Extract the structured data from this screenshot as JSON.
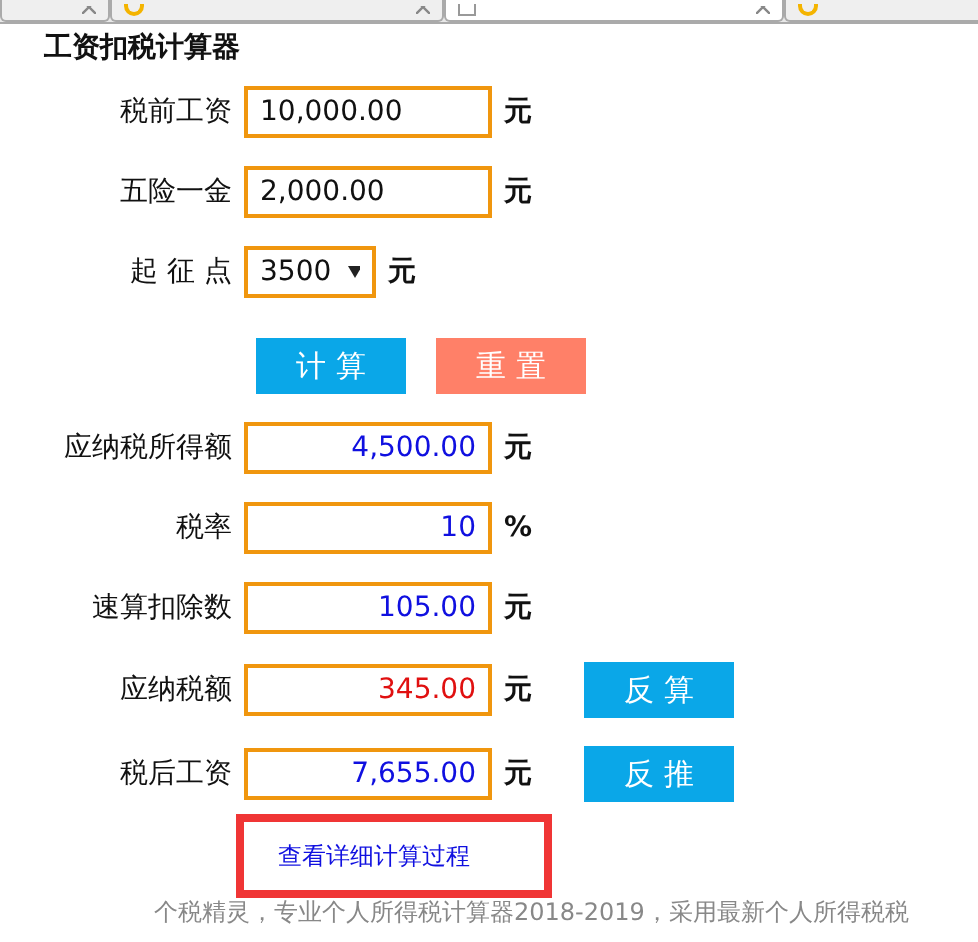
{
  "tabs": [
    {
      "selected": false
    },
    {
      "selected": false
    },
    {
      "selected": true
    },
    {
      "selected": false
    }
  ],
  "title": "工资扣税计算器",
  "inputs": [
    {
      "kind": "input",
      "label": "税前工资",
      "value": "10,000.00",
      "unit": "元"
    },
    {
      "kind": "input",
      "label": "五险一金",
      "value": "2,000.00",
      "unit": "元"
    },
    {
      "kind": "select",
      "label": "起 征 点",
      "value": "3500",
      "unit": "元"
    }
  ],
  "buttons": [
    {
      "label": "计 算",
      "color": "#0aa7e8"
    },
    {
      "label": "重 置",
      "color": "#ff8068"
    }
  ],
  "results": [
    {
      "label": "应纳税所得额",
      "value": "4,500.00",
      "unit": "元",
      "color": "#1010e0"
    },
    {
      "label": "税率",
      "value": "10",
      "unit": "%",
      "color": "#1010e0"
    },
    {
      "label": "速算扣除数",
      "value": "105.00",
      "unit": "元",
      "color": "#1010e0"
    },
    {
      "label": "应纳税额",
      "value": "345.00",
      "unit": "元",
      "color": "#e01010",
      "action": "反 算"
    },
    {
      "label": "税后工资",
      "value": "7,655.00",
      "unit": "元",
      "color": "#1010e0",
      "action": "反 推"
    }
  ],
  "detail_link": "查看详细计算过程",
  "footer": "个税精灵，专业个人所得税计算器2018-2019，采用最新个人所得税税"
}
